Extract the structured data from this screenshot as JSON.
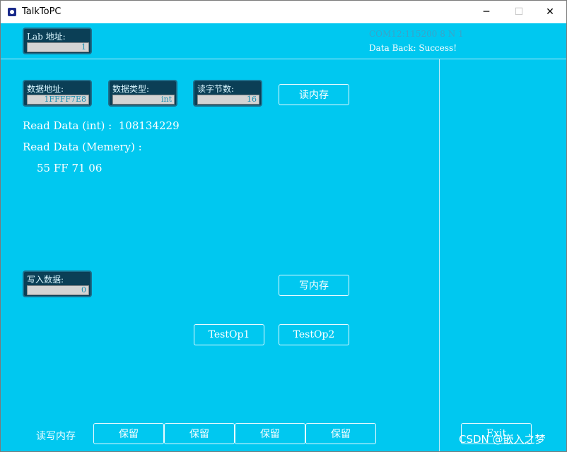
{
  "window": {
    "title": "TalkToPC",
    "minimize": "─",
    "maximize": "☐",
    "close": "✕"
  },
  "header": {
    "lab_addr_label": "Lab 地址:",
    "lab_addr_value": "1",
    "com_status": "COM12:115200 8 N 1",
    "data_back": "Data Back: Success!"
  },
  "read_section": {
    "data_addr_label": "数据地址:",
    "data_addr_value": "1FFFF7E8",
    "data_type_label": "数据类型:",
    "data_type_value": "int",
    "read_bytes_label": "读字节数:",
    "read_bytes_value": "16",
    "read_button": "读内存",
    "read_int_line": "Read Data (int) :  108134229",
    "read_mem_line": "Read Data (Memery) :",
    "mem_bytes": "55 FF 71 06"
  },
  "write_section": {
    "write_data_label": "写入数据:",
    "write_data_value": "0",
    "write_button": "写内存"
  },
  "test_buttons": [
    "TestOp1",
    "TestOp2"
  ],
  "bottom_bar": {
    "label": "读写内存",
    "buttons": [
      "保留",
      "保留",
      "保留",
      "保留"
    ],
    "right_button": "Exit"
  },
  "watermark": "CSDN @嵌入之梦",
  "colors": {
    "background": "#00c8f0",
    "field_box": "#0b3f56",
    "status_dim": "#3aa3c8"
  }
}
